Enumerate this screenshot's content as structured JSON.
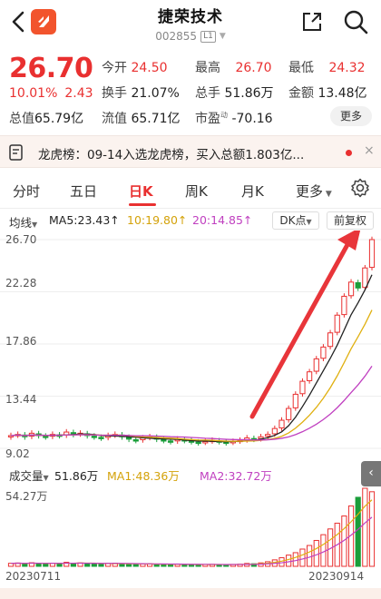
{
  "header": {
    "stock_name": "捷荣技术",
    "stock_code": "002855",
    "level_badge": "L1",
    "icons": [
      "back-arrow-icon",
      "app-logo-icon",
      "share-icon",
      "search-icon"
    ]
  },
  "quote": {
    "price": "26.70",
    "change_pct": "10.01%",
    "change_amt": "2.43",
    "open_label": "今开",
    "open": "24.50",
    "high_label": "最高",
    "high": "26.70",
    "low_label": "最低",
    "low": "24.32",
    "turnover_label": "换手",
    "turnover": "21.07%",
    "volume_label": "总手",
    "volume": "51.86万",
    "amount_label": "金额",
    "amount": "13.48亿",
    "mktcap_label": "总值",
    "mktcap": "65.79亿",
    "float_label": "流值",
    "float_cap": "65.71亿",
    "pe_label": "市盈",
    "pe_sup": "动",
    "pe": "-70.16",
    "more_label": "更多"
  },
  "notice": {
    "text": "龙虎榜：09-14入选龙虎榜，买入总额1.803亿...",
    "close": "×"
  },
  "tabs": {
    "items": [
      "分时",
      "五日",
      "日K",
      "周K",
      "月K",
      "更多"
    ],
    "active": "日K"
  },
  "indicators": {
    "ma_label": "均线",
    "ma5": "MA5:23.43↑",
    "ma10": "10:19.80↑",
    "ma20": "20:14.85↑",
    "dk_label": "DK点",
    "fq_label": "前复权"
  },
  "volume_panel": {
    "label": "成交量",
    "total": "51.86万",
    "ma1": "MA1:48.36万",
    "ma2": "MA2:32.72万",
    "ymax_label": "54.27万"
  },
  "colors": {
    "up": "#e93030",
    "down": "#1a9e3a",
    "ma5": "#222222",
    "ma10": "#e0b010",
    "ma20": "#c040c0",
    "arrow": "#e8353a"
  },
  "chart_data": {
    "type": "candlestick",
    "y_ticks": [
      "26.70",
      "22.28",
      "17.86",
      "13.44",
      "9.02"
    ],
    "ylim": [
      9.02,
      26.7
    ],
    "x_labels": [
      "20230711",
      "20230914"
    ],
    "closes": [
      10.1,
      10.2,
      10.0,
      10.3,
      10.1,
      10.0,
      10.2,
      10.1,
      10.4,
      10.2,
      10.3,
      10.1,
      10.0,
      9.9,
      10.1,
      10.2,
      10.0,
      9.8,
      9.7,
      9.9,
      10.0,
      9.8,
      9.7,
      9.6,
      9.8,
      9.7,
      9.6,
      9.5,
      9.6,
      9.7,
      9.6,
      9.5,
      9.6,
      9.7,
      9.9,
      9.8,
      10.0,
      10.2,
      10.7,
      11.4,
      12.4,
      13.6,
      14.7,
      15.5,
      16.6,
      17.6,
      18.8,
      20.3,
      21.9,
      23.1,
      22.6,
      24.3,
      26.7
    ],
    "volumes": [
      2.1,
      2.3,
      1.9,
      2.5,
      2.0,
      1.8,
      2.2,
      2.0,
      2.8,
      2.1,
      2.4,
      2.0,
      1.7,
      1.6,
      2.0,
      2.2,
      1.8,
      1.5,
      1.4,
      1.6,
      1.8,
      1.5,
      1.3,
      1.2,
      1.5,
      1.4,
      1.2,
      1.1,
      1.3,
      1.4,
      1.2,
      1.1,
      1.3,
      1.5,
      2.0,
      1.8,
      2.4,
      3.2,
      4.5,
      6.0,
      7.8,
      9.5,
      12.0,
      14.5,
      18.0,
      22.0,
      26.0,
      30.0,
      35.0,
      42.0,
      48.0,
      54.27,
      51.86
    ]
  }
}
